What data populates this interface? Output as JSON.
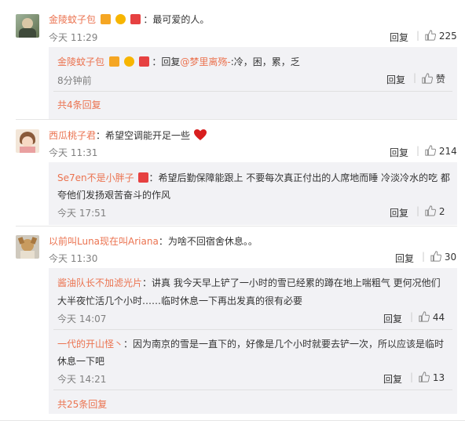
{
  "comments": [
    {
      "user": "金陵蚊子包",
      "text": "：最可爱的人。",
      "time": "今天 11:29",
      "reply_label": "回复",
      "likes": "225",
      "replies": [
        {
          "user": "金陵蚊子包",
          "text": "：回复",
          "mention": "@梦里离殇-",
          "text2": ":冷，困，累，乏",
          "time": "8分钟前",
          "reply_label": "回复",
          "likes": "赞"
        }
      ],
      "more": "共4条回复"
    },
    {
      "user": "西瓜桃子君",
      "text": "：希望空调能开足一些",
      "time": "今天 11:31",
      "reply_label": "回复",
      "likes": "214",
      "replies": [
        {
          "user": "Se7en不是小胖子",
          "text_line1": "：希望后勤保障能跟上 不要每次真正付出的人席地而睡 冷淡冷水的吃 都",
          "text_line2": "夸他们发扬艰苦奋斗的作风",
          "time": "今天 17:51",
          "reply_label": "回复",
          "likes": "2"
        }
      ]
    },
    {
      "user": "以前叫Luna现在叫Ariana",
      "text": "：为啥不回宿舍休息。。",
      "time": "今天 11:30",
      "reply_label": "回复",
      "likes": "30",
      "replies": [
        {
          "user": "酱油队长不加滤光片",
          "text_line1": "：讲真 我今天早上铲了一小时的雪已经累的蹲在地上喘粗气 更何况他们",
          "text_line2": "大半夜忙活几个小时……临时休息一下再出发真的很有必要",
          "time": "今天 14:07",
          "reply_label": "回复",
          "likes": "44"
        },
        {
          "user": "一代的开山怪丶",
          "text_line1": "：因为南京的雪是一直下的，好像是几个小时就要去铲一次，所以应该是临时",
          "text_line2": "休息一下吧",
          "time": "今天 14:21",
          "reply_label": "回复",
          "likes": "13"
        }
      ],
      "more": "共25条回复"
    }
  ],
  "colors": {
    "username": "#eb7350",
    "reply_bg": "#f2f2f5",
    "meta": "#808080"
  },
  "icons": {
    "like": "thumbs-up-icon",
    "verified": "v-badge-icon",
    "heart": "red-heart-emoji"
  }
}
